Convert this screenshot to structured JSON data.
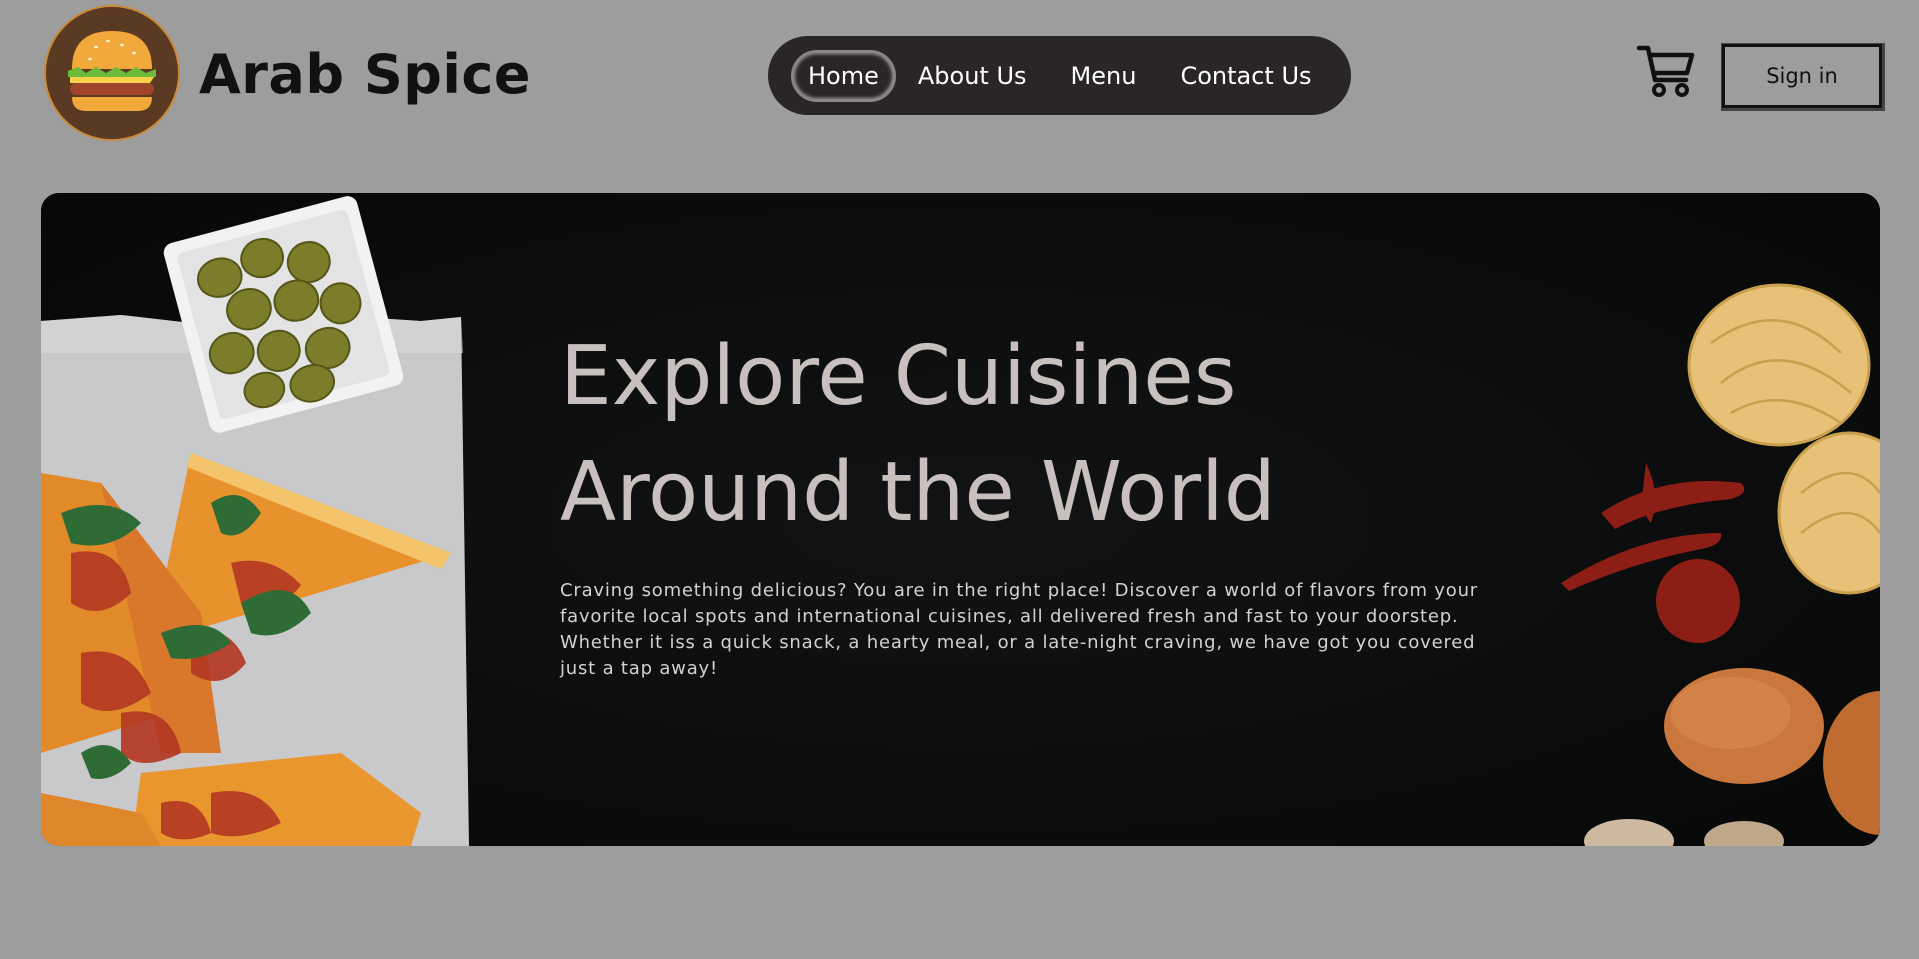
{
  "brand": {
    "name": "Arab Spice",
    "logo_icon": "burger-icon"
  },
  "nav": {
    "items": [
      {
        "label": "Home",
        "active": true
      },
      {
        "label": "About Us",
        "active": false
      },
      {
        "label": "Menu",
        "active": false
      },
      {
        "label": "Contact Us",
        "active": false
      }
    ]
  },
  "header_actions": {
    "cart_icon": "shopping-cart-icon",
    "signin_label": "Sign in"
  },
  "hero": {
    "title_line1": "Explore Cuisines",
    "title_line2": "Around the World",
    "description": "Craving something delicious? You are in the right place! Discover a world of flavors from your favorite local spots and international cuisines, all delivered fresh and fast to your doorstep. Whether it iss a quick snack, a hearty meal, or a late-night craving, we have got you covered just a tap away!"
  },
  "colors": {
    "page_background": "#9d9d9d",
    "nav_background": "#2a2626",
    "hero_background": "#0e0e0f",
    "hero_text": "#c8c0be"
  }
}
